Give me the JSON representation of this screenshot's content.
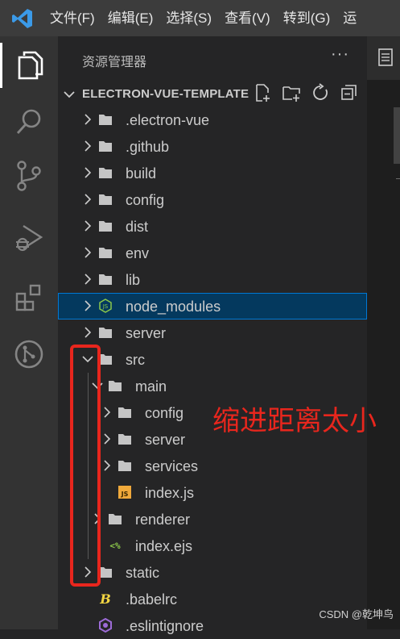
{
  "menu": {
    "items": [
      "文件(F)",
      "编辑(E)",
      "选择(S)",
      "查看(V)",
      "转到(G)",
      "运"
    ]
  },
  "activity_bar": {
    "icons": [
      "explorer-icon",
      "search-icon",
      "source-control-icon",
      "run-debug-icon",
      "extensions-icon",
      "remote-explorer-icon"
    ]
  },
  "explorer": {
    "title": "资源管理器",
    "more": "···",
    "project": "ELECTRON-VUE-TEMPLATE",
    "rows": [
      {
        "label": ".electron-vue",
        "type": "folder",
        "state": "collapsed",
        "depth": 0
      },
      {
        "label": ".github",
        "type": "folder",
        "state": "collapsed",
        "depth": 0
      },
      {
        "label": "build",
        "type": "folder",
        "state": "collapsed",
        "depth": 0
      },
      {
        "label": "config",
        "type": "folder",
        "state": "collapsed",
        "depth": 0
      },
      {
        "label": "dist",
        "type": "folder",
        "state": "collapsed",
        "depth": 0
      },
      {
        "label": "env",
        "type": "folder",
        "state": "collapsed",
        "depth": 0
      },
      {
        "label": "lib",
        "type": "folder",
        "state": "collapsed",
        "depth": 0
      },
      {
        "label": "node_modules",
        "type": "node-folder",
        "state": "collapsed",
        "depth": 0,
        "selected": true
      },
      {
        "label": "server",
        "type": "folder",
        "state": "collapsed",
        "depth": 0
      },
      {
        "label": "src",
        "type": "folder",
        "state": "expanded",
        "depth": 0
      },
      {
        "label": "main",
        "type": "folder",
        "state": "expanded",
        "depth": 1
      },
      {
        "label": "config",
        "type": "folder",
        "state": "collapsed",
        "depth": 2
      },
      {
        "label": "server",
        "type": "folder",
        "state": "collapsed",
        "depth": 2
      },
      {
        "label": "services",
        "type": "folder",
        "state": "collapsed",
        "depth": 2
      },
      {
        "label": "index.js",
        "type": "js-file",
        "state": "none",
        "depth": 2
      },
      {
        "label": "renderer",
        "type": "folder",
        "state": "collapsed",
        "depth": 1
      },
      {
        "label": "index.ejs",
        "type": "ejs-file",
        "state": "none",
        "depth": 1
      },
      {
        "label": "static",
        "type": "folder",
        "state": "collapsed",
        "depth": 0
      },
      {
        "label": ".babelrc",
        "type": "babel-file",
        "state": "none",
        "depth": 0
      },
      {
        "label": ".eslintignore",
        "type": "eslint-file",
        "state": "none",
        "depth": 0
      }
    ]
  },
  "annotation": {
    "text": "缩进距离太小"
  },
  "watermark": "CSDN @乾坤鸟",
  "colors": {
    "accent": "#0078d4",
    "annotation": "#e8261d",
    "folder": "#c5c5c5"
  }
}
